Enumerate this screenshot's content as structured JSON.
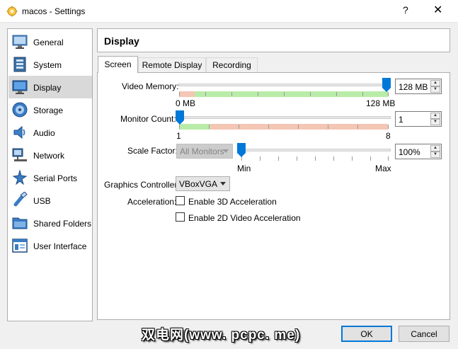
{
  "window": {
    "title": "macos - Settings",
    "help_glyph": "?",
    "close_glyph": "✕"
  },
  "sidebar": {
    "items": [
      {
        "label": "General",
        "icon": "general-icon",
        "selected": false
      },
      {
        "label": "System",
        "icon": "system-icon",
        "selected": false
      },
      {
        "label": "Display",
        "icon": "display-icon",
        "selected": true
      },
      {
        "label": "Storage",
        "icon": "storage-icon",
        "selected": false
      },
      {
        "label": "Audio",
        "icon": "audio-icon",
        "selected": false
      },
      {
        "label": "Network",
        "icon": "network-icon",
        "selected": false
      },
      {
        "label": "Serial Ports",
        "icon": "serial-ports-icon",
        "selected": false
      },
      {
        "label": "USB",
        "icon": "usb-icon",
        "selected": false
      },
      {
        "label": "Shared Folders",
        "icon": "shared-folders-icon",
        "selected": false
      },
      {
        "label": "User Interface",
        "icon": "user-interface-icon",
        "selected": false
      }
    ]
  },
  "header": {
    "title": "Display"
  },
  "tabs": [
    {
      "label": "Screen",
      "active": true
    },
    {
      "label": "Remote Display",
      "active": false
    },
    {
      "label": "Recording",
      "active": false
    }
  ],
  "screen": {
    "video_memory": {
      "label": "Video Memory:",
      "value": "128 MB",
      "min_label": "0 MB",
      "max_label": "128 MB",
      "level": 1.0
    },
    "monitor_count": {
      "label": "Monitor Count:",
      "value": "1",
      "min_label": "1",
      "max_label": "8",
      "level": 0.0
    },
    "scale_factor": {
      "label": "Scale Factor:",
      "monitor_select": "All Monitors",
      "value": "100%",
      "min_label": "Min",
      "max_label": "Max",
      "level": 0.0
    },
    "graphics_controller": {
      "label": "Graphics Controller:",
      "value": "VBoxVGA"
    },
    "acceleration": {
      "label": "Acceleration:",
      "enable_3d": {
        "label": "Enable 3D Acceleration",
        "checked": false
      },
      "enable_2d": {
        "label": "Enable 2D Video Acceleration",
        "checked": false
      }
    }
  },
  "footer": {
    "ok_label": "OK",
    "cancel_label": "Cancel",
    "watermark": "双电网(www. pcpc. me)"
  },
  "colors": {
    "accent": "#0078d7",
    "selected_bg": "#d9d9d9",
    "zone_red": "#f4c6b4",
    "zone_green": "#b9eca8"
  }
}
